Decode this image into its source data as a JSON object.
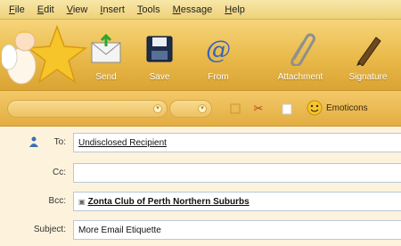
{
  "menu": [
    "File",
    "Edit",
    "View",
    "Insert",
    "Tools",
    "Message",
    "Help"
  ],
  "toolbar": {
    "send_label": "Send",
    "save_label": "Save",
    "from_label": "From",
    "attachment_label": "Attachment",
    "signature_label": "Signature"
  },
  "format": {
    "emoticons_label": "Emoticons"
  },
  "fields": {
    "to_label": "To:",
    "to_value": "Undisclosed Recipient",
    "cc_label": "Cc:",
    "cc_value": "",
    "bcc_label": "Bcc:",
    "bcc_value": "Zonta Club of Perth Northern Suburbs",
    "subject_label": "Subject:",
    "subject_value": "More Email Etiquette"
  },
  "colors": {
    "toolbar": "#e9b94a",
    "field_bg": "#fdf3dc",
    "field_border": "#b9c7d9"
  },
  "icons": [
    "angel-star-icon",
    "send-envelope-icon",
    "save-floppy-icon",
    "from-at-icon",
    "paperclip-icon",
    "pen-icon",
    "smiley-icon",
    "person-icon"
  ]
}
